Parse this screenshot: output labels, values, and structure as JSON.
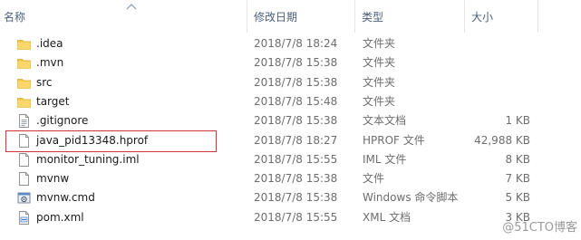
{
  "columns": {
    "name": "名称",
    "date": "修改日期",
    "type": "类型",
    "size": "大小"
  },
  "files": [
    {
      "name": ".idea",
      "date": "2018/7/8 18:24",
      "type": "文件夹",
      "size": "",
      "icon": "folder-icon"
    },
    {
      "name": ".mvn",
      "date": "2018/7/8 15:38",
      "type": "文件夹",
      "size": "",
      "icon": "folder-icon"
    },
    {
      "name": "src",
      "date": "2018/7/8 15:38",
      "type": "文件夹",
      "size": "",
      "icon": "folder-icon"
    },
    {
      "name": "target",
      "date": "2018/7/8 15:48",
      "type": "文件夹",
      "size": "",
      "icon": "folder-icon"
    },
    {
      "name": ".gitignore",
      "date": "2018/7/8 15:38",
      "type": "文本文档",
      "size": "1 KB",
      "icon": "text-file-icon"
    },
    {
      "name": "java_pid13348.hprof",
      "date": "2018/7/8 18:27",
      "type": "HPROF 文件",
      "size": "42,988 KB",
      "icon": "blank-file-icon"
    },
    {
      "name": "monitor_tuning.iml",
      "date": "2018/7/8 15:55",
      "type": "IML 文件",
      "size": "8 KB",
      "icon": "blank-file-icon"
    },
    {
      "name": "mvnw",
      "date": "2018/7/8 15:38",
      "type": "文件",
      "size": "7 KB",
      "icon": "blank-file-icon"
    },
    {
      "name": "mvnw.cmd",
      "date": "2018/7/8 15:38",
      "type": "Windows 命令脚本",
      "size": "5 KB",
      "icon": "cmd-script-icon"
    },
    {
      "name": "pom.xml",
      "date": "2018/7/8 15:55",
      "type": "XML 文档",
      "size": "3 KB",
      "icon": "xml-file-icon"
    }
  ],
  "watermark": "@51CTO博客",
  "colors": {
    "folder": "#f5c542",
    "highlight_border": "#d0343b",
    "header_text": "#4c607a"
  }
}
